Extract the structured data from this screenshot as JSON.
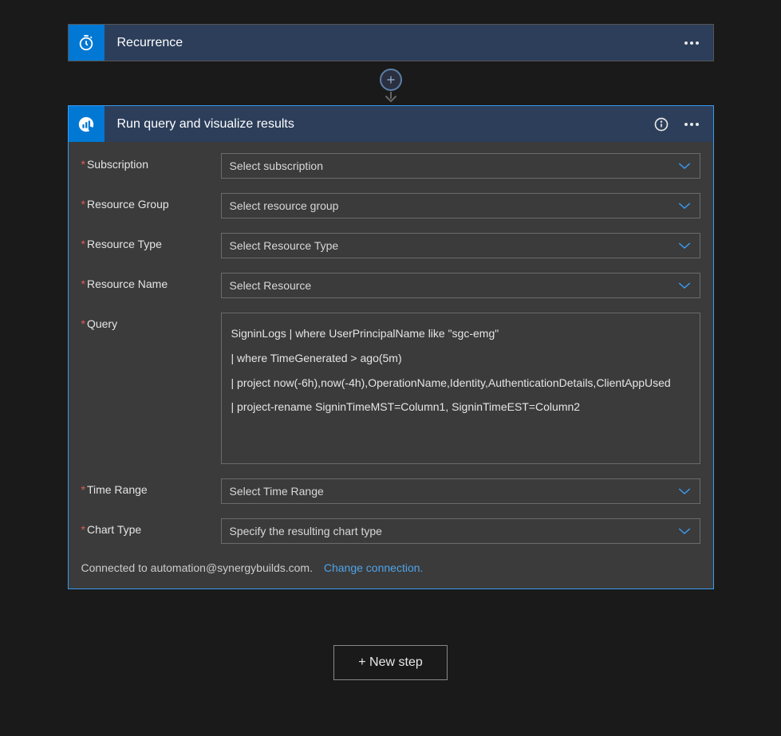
{
  "recurrence": {
    "title": "Recurrence"
  },
  "query": {
    "title": "Run query and visualize results",
    "fields": {
      "subscription": {
        "label": "Subscription",
        "placeholder": "Select subscription"
      },
      "resourceGroup": {
        "label": "Resource Group",
        "placeholder": "Select resource group"
      },
      "resourceType": {
        "label": "Resource Type",
        "placeholder": "Select Resource Type"
      },
      "resourceName": {
        "label": "Resource Name",
        "placeholder": "Select Resource"
      },
      "query": {
        "label": "Query",
        "value": "SigninLogs | where UserPrincipalName like \"sgc-emg\"\n| where TimeGenerated > ago(5m)\n| project now(-6h),now(-4h),OperationName,Identity,AuthenticationDetails,ClientAppUsed\n| project-rename SigninTimeMST=Column1, SigninTimeEST=Column2"
      },
      "timeRange": {
        "label": "Time Range",
        "placeholder": "Select Time Range"
      },
      "chartType": {
        "label": "Chart Type",
        "placeholder": "Specify the resulting chart type"
      }
    },
    "connection": {
      "text": "Connected to automation@synergybuilds.com.",
      "change": "Change connection."
    }
  },
  "newStep": "+ New step",
  "requiredMark": "*"
}
